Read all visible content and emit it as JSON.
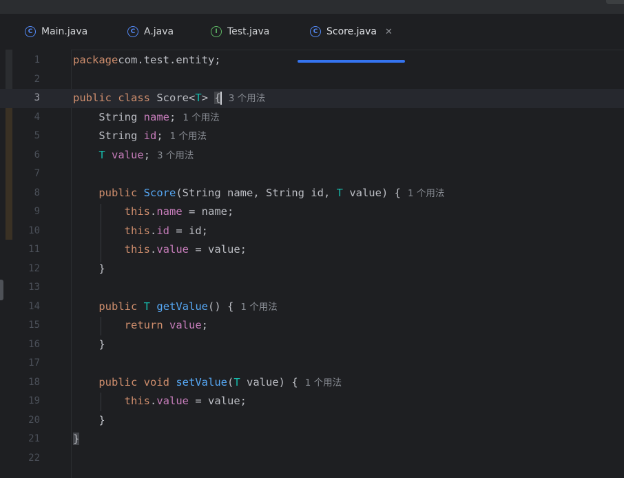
{
  "tabs": [
    {
      "name": "tab-main",
      "icon": "class-run-icon",
      "glyph": "C",
      "label": "Main.java"
    },
    {
      "name": "tab-a",
      "icon": "class-icon",
      "glyph": "C",
      "label": "A.java"
    },
    {
      "name": "tab-test",
      "icon": "interface-icon",
      "glyph": "I",
      "label": "Test.java"
    },
    {
      "name": "tab-score",
      "icon": "class-icon",
      "glyph": "C",
      "label": "Score.java",
      "active": true
    }
  ],
  "close_glyph": "✕",
  "colors": {
    "keyword": "#cf8e6d",
    "field": "#c77dbb",
    "type_param": "#16baac",
    "method": "#56a8f5",
    "text": "#bcbec4",
    "hint": "#868a91",
    "accent": "#3574f0",
    "background": "#1e1f22"
  },
  "current_line": 3,
  "lines": [
    {
      "n": "1",
      "tokens": [
        [
          "kw",
          "package"
        ],
        [
          "",
          "com.test.entity;"
        ]
      ]
    },
    {
      "n": "2",
      "tokens": []
    },
    {
      "n": "3",
      "tokens": [
        [
          "kw",
          "public"
        ],
        [
          "",
          " "
        ],
        [
          "kw",
          "class"
        ],
        [
          "",
          " Score<"
        ],
        [
          "tp",
          "T"
        ],
        [
          "",
          "> "
        ],
        [
          "bracehl",
          "{"
        ],
        [
          "caret",
          ""
        ],
        [
          "hint",
          "3 个用法"
        ]
      ]
    },
    {
      "n": "4",
      "tokens": [
        [
          "",
          "    String "
        ],
        [
          "fld",
          "name"
        ],
        [
          "",
          ";"
        ],
        [
          "hint",
          "1 个用法"
        ]
      ]
    },
    {
      "n": "5",
      "tokens": [
        [
          "",
          "    String "
        ],
        [
          "fld",
          "id"
        ],
        [
          "",
          ";"
        ],
        [
          "hint",
          "1 个用法"
        ]
      ]
    },
    {
      "n": "6",
      "tokens": [
        [
          "",
          "    "
        ],
        [
          "tp",
          "T"
        ],
        [
          "",
          " "
        ],
        [
          "fld",
          "value"
        ],
        [
          "",
          ";"
        ],
        [
          "hint",
          "3 个用法"
        ]
      ]
    },
    {
      "n": "7",
      "tokens": []
    },
    {
      "n": "8",
      "tokens": [
        [
          "",
          "    "
        ],
        [
          "kw",
          "public"
        ],
        [
          "",
          " "
        ],
        [
          "fn",
          "Score"
        ],
        [
          "",
          "(String name, String id, "
        ],
        [
          "tp",
          "T"
        ],
        [
          "",
          " value) {"
        ],
        [
          "hint",
          "1 个用法"
        ]
      ]
    },
    {
      "n": "9",
      "tokens": [
        [
          "",
          "        "
        ],
        [
          "kw",
          "this"
        ],
        [
          "",
          "."
        ],
        [
          "fld",
          "name"
        ],
        [
          "",
          " = name;"
        ]
      ]
    },
    {
      "n": "10",
      "tokens": [
        [
          "",
          "        "
        ],
        [
          "kw",
          "this"
        ],
        [
          "",
          "."
        ],
        [
          "fld",
          "id"
        ],
        [
          "",
          " = id;"
        ]
      ]
    },
    {
      "n": "11",
      "tokens": [
        [
          "",
          "        "
        ],
        [
          "kw",
          "this"
        ],
        [
          "",
          "."
        ],
        [
          "fld",
          "value"
        ],
        [
          "",
          " = value;"
        ]
      ]
    },
    {
      "n": "12",
      "tokens": [
        [
          "",
          "    }"
        ]
      ]
    },
    {
      "n": "13",
      "tokens": []
    },
    {
      "n": "14",
      "tokens": [
        [
          "",
          "    "
        ],
        [
          "kw",
          "public"
        ],
        [
          "",
          " "
        ],
        [
          "tp",
          "T"
        ],
        [
          "",
          " "
        ],
        [
          "fn",
          "getValue"
        ],
        [
          "",
          "() {"
        ],
        [
          "hint",
          "1 个用法"
        ]
      ]
    },
    {
      "n": "15",
      "tokens": [
        [
          "",
          "        "
        ],
        [
          "kw",
          "return"
        ],
        [
          "",
          " "
        ],
        [
          "fld",
          "value"
        ],
        [
          "",
          ";"
        ]
      ]
    },
    {
      "n": "16",
      "tokens": [
        [
          "",
          "    }"
        ]
      ]
    },
    {
      "n": "17",
      "tokens": []
    },
    {
      "n": "18",
      "tokens": [
        [
          "",
          "    "
        ],
        [
          "kw",
          "public"
        ],
        [
          "",
          " "
        ],
        [
          "kw",
          "void"
        ],
        [
          "",
          " "
        ],
        [
          "fn",
          "setValue"
        ],
        [
          "",
          "("
        ],
        [
          "tp",
          "T"
        ],
        [
          "",
          " value) {"
        ],
        [
          "hint",
          "1 个用法"
        ]
      ]
    },
    {
      "n": "19",
      "tokens": [
        [
          "",
          "        "
        ],
        [
          "kw",
          "this"
        ],
        [
          "",
          "."
        ],
        [
          "fld",
          "value"
        ],
        [
          "",
          " = value;"
        ]
      ]
    },
    {
      "n": "20",
      "tokens": [
        [
          "",
          "    }"
        ]
      ]
    },
    {
      "n": "21",
      "tokens": [
        [
          "bracehl",
          "}"
        ]
      ]
    },
    {
      "n": "22",
      "tokens": []
    }
  ]
}
